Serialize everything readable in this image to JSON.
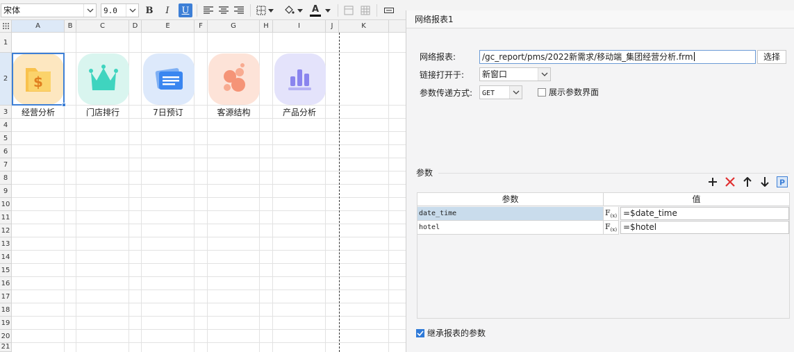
{
  "toolbar": {
    "font_name": "宋体",
    "font_size": "9.0",
    "bold_label": "B",
    "italic_label": "I",
    "underline_label": "U",
    "font_color_label": "A",
    "font_color": "#000000"
  },
  "sheet": {
    "columns": [
      "A",
      "B",
      "C",
      "D",
      "E",
      "F",
      "G",
      "H",
      "I",
      "J",
      "K"
    ],
    "rows": [
      "1",
      "2",
      "3",
      "4",
      "5",
      "6",
      "7",
      "8",
      "9",
      "10",
      "11",
      "12",
      "13",
      "14",
      "15",
      "16",
      "17",
      "18",
      "19",
      "20",
      "21"
    ],
    "captions": [
      "经营分析",
      "门店排行",
      "7日预订",
      "客源结构",
      "产品分析"
    ],
    "selected_cell": "A2"
  },
  "dialog": {
    "title": "网络报表1",
    "report_label": "网络报表:",
    "report_path": "/gc_report/pms/2022新需求/移动端_集团经营分析.frm",
    "choose_button": "选择",
    "open_in_label": "链接打开于:",
    "open_in_value": "新窗口",
    "method_label": "参数传递方式:",
    "method_value": "GET",
    "show_params_label": "展示参数界面",
    "show_params_checked": false,
    "params_group_label": "参数",
    "param_col_name": "参数",
    "param_col_value": "值",
    "params": [
      {
        "name": "date_time",
        "value": "=$date_time"
      },
      {
        "name": "hotel",
        "value": "=$hotel"
      }
    ],
    "fx_label": "F(x)",
    "inherit_label": "继承报表的参数",
    "inherit_checked": true,
    "tool_add": "+",
    "tool_param": "P"
  },
  "colors": {
    "accent": "#3d7fd6",
    "delete_red": "#e03030",
    "selected_row": "#c9dcec"
  }
}
